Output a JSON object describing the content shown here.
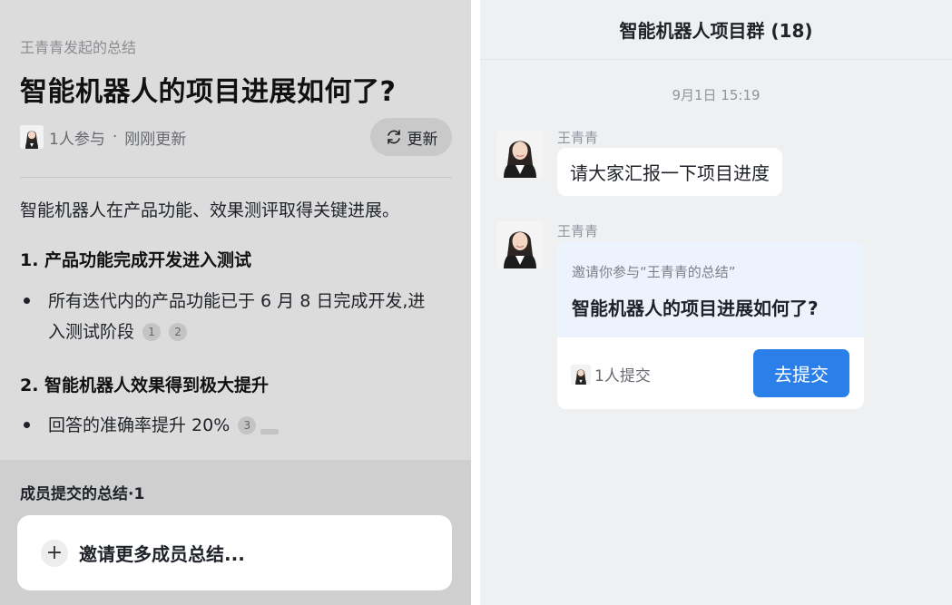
{
  "summary_doc": {
    "initiator": "王青青发起的总结",
    "title": "智能机器人的项目进展如何了?",
    "participants": "1人参与",
    "separator": "·",
    "updated": "刚刚更新",
    "update_button": "更新",
    "intro": "智能机器人在产品功能、效果测评取得关键进展。",
    "sections": [
      {
        "heading": "1. 产品功能完成开发进入测试",
        "bullet": "所有迭代内的产品功能已于 6 月 8 日完成开发,进入测试阶段",
        "refs": [
          "1",
          "2"
        ]
      },
      {
        "heading": "2. 智能机器人效果得到极大提升",
        "bullet": "回答的准确率提升 20%",
        "refs": [
          "3"
        ]
      }
    ],
    "members_title": "成员提交的总结·1",
    "invite_label": "邀请更多成员总结..."
  },
  "chat": {
    "title": "智能机器人项目群 (18)",
    "timestamp": "9月1日 15:19",
    "messages": [
      {
        "sender": "王青青",
        "text": "请大家汇报一下项目进度"
      },
      {
        "sender": "王青青",
        "card": {
          "subtitle": "邀请你参与“王青青的总结”",
          "title": "智能机器人的项目进展如何了?",
          "count": "1人提交",
          "button": "去提交"
        }
      }
    ]
  },
  "colors": {
    "accent": "#2a7fe8",
    "left_bg": "#dcdcdc",
    "right_bg": "#eff0f1",
    "card_header_bg": "#edf3fc"
  }
}
